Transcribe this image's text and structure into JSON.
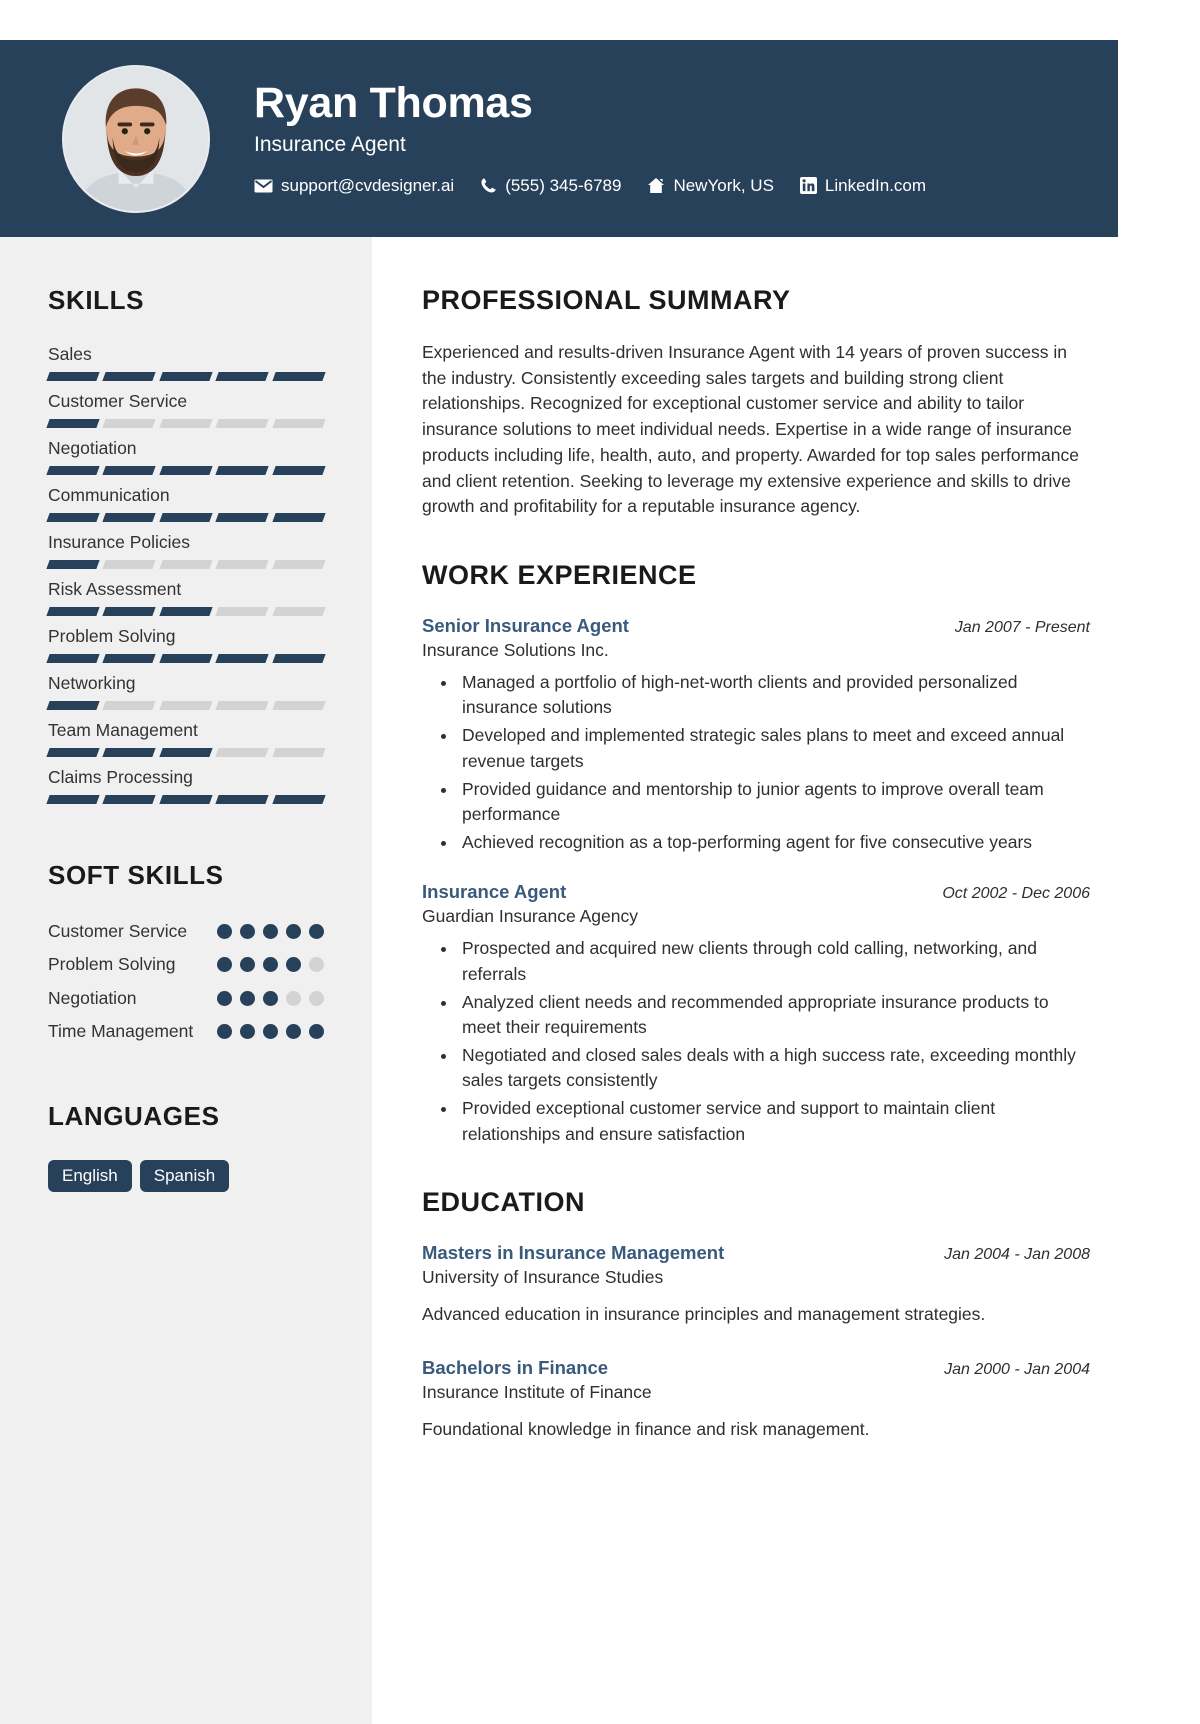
{
  "theme": {
    "navy": "#28415a",
    "sidebar_bg": "#f0f0f0",
    "title_blue": "#3a5a7d",
    "bar_empty": "#d3d3d3"
  },
  "header": {
    "name": "Ryan Thomas",
    "role": "Insurance Agent",
    "contacts": [
      {
        "icon": "envelope-icon",
        "text": "support@cvdesigner.ai"
      },
      {
        "icon": "phone-icon",
        "text": "(555) 345-6789"
      },
      {
        "icon": "home-icon",
        "text": "NewYork, US"
      },
      {
        "icon": "linkedin-icon",
        "text": "LinkedIn.com"
      }
    ]
  },
  "sidebar": {
    "skills_heading": "SKILLS",
    "skills": [
      {
        "name": "Sales",
        "level": 5,
        "max": 5
      },
      {
        "name": "Customer Service",
        "level": 1,
        "max": 5
      },
      {
        "name": "Negotiation",
        "level": 5,
        "max": 5
      },
      {
        "name": "Communication",
        "level": 5,
        "max": 5
      },
      {
        "name": "Insurance Policies",
        "level": 1,
        "max": 5
      },
      {
        "name": "Risk Assessment",
        "level": 3,
        "max": 5
      },
      {
        "name": "Problem Solving",
        "level": 5,
        "max": 5
      },
      {
        "name": "Networking",
        "level": 1,
        "max": 5
      },
      {
        "name": "Team Management",
        "level": 3,
        "max": 5
      },
      {
        "name": "Claims Processing",
        "level": 5,
        "max": 5
      }
    ],
    "soft_skills_heading": "SOFT SKILLS",
    "soft_skills": [
      {
        "name": "Customer Service",
        "level": 5,
        "max": 5
      },
      {
        "name": "Problem Solving",
        "level": 4,
        "max": 5
      },
      {
        "name": "Negotiation",
        "level": 3,
        "max": 5
      },
      {
        "name": "Time Management",
        "level": 5,
        "max": 5
      }
    ],
    "languages_heading": "LANGUAGES",
    "languages": [
      "English",
      "Spanish"
    ]
  },
  "main": {
    "summary_heading": "PROFESSIONAL SUMMARY",
    "summary_text": "Experienced and results-driven Insurance Agent with 14 years of proven success in the industry. Consistently exceeding sales targets and building strong client relationships. Recognized for exceptional customer service and ability to tailor insurance solutions to meet individual needs. Expertise in a wide range of insurance products including life, health, auto, and property. Awarded for top sales performance and client retention. Seeking to leverage my extensive experience and skills to drive growth and profitability for a reputable insurance agency.",
    "experience_heading": "WORK EXPERIENCE",
    "experience": [
      {
        "title": "Senior Insurance Agent",
        "date": "Jan 2007 - Present",
        "org": "Insurance Solutions Inc.",
        "bullets": [
          "Managed a portfolio of high-net-worth clients and provided personalized insurance solutions",
          "Developed and implemented strategic sales plans to meet and exceed annual revenue targets",
          "Provided guidance and mentorship to junior agents to improve overall team performance",
          "Achieved recognition as a top-performing agent for five consecutive years"
        ]
      },
      {
        "title": "Insurance Agent",
        "date": "Oct 2002 - Dec 2006",
        "org": "Guardian Insurance Agency",
        "bullets": [
          "Prospected and acquired new clients through cold calling, networking, and referrals",
          "Analyzed client needs and recommended appropriate insurance products to meet their requirements",
          "Negotiated and closed sales deals with a high success rate, exceeding monthly sales targets consistently",
          "Provided exceptional customer service and support to maintain client relationships and ensure satisfaction"
        ]
      }
    ],
    "education_heading": "EDUCATION",
    "education": [
      {
        "title": "Masters in Insurance Management",
        "date": "Jan 2004 - Jan 2008",
        "org": "University of Insurance Studies",
        "desc": "Advanced education in insurance principles and management strategies."
      },
      {
        "title": "Bachelors in Finance",
        "date": "Jan 2000 - Jan 2004",
        "org": "Insurance Institute of Finance",
        "desc": "Foundational knowledge in finance and risk management."
      }
    ]
  }
}
